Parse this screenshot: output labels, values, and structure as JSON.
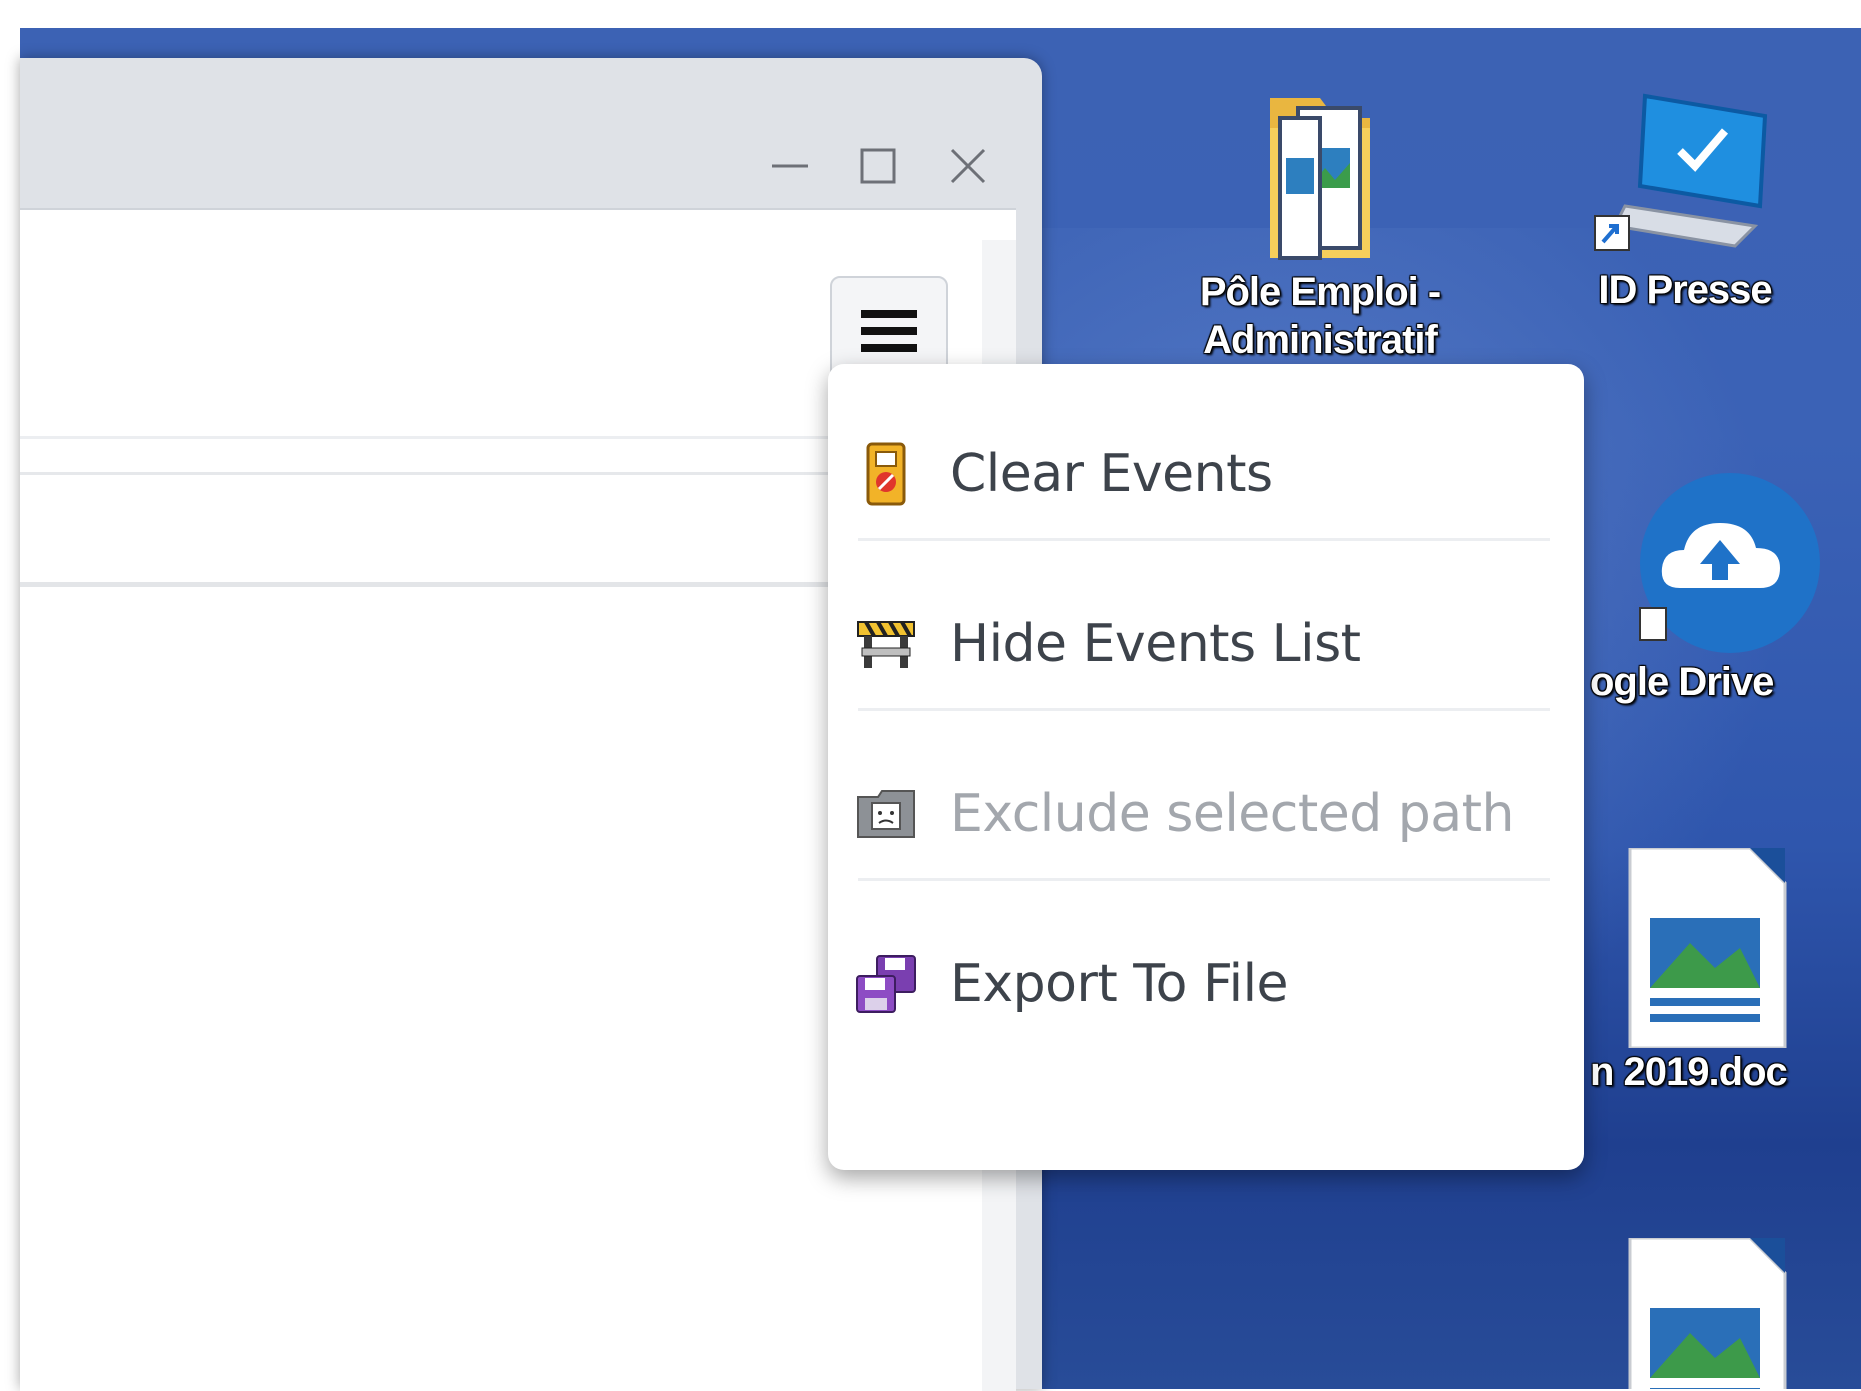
{
  "window": {
    "controls": {
      "minimize_icon": "minimize-icon",
      "maximize_icon": "maximize-icon",
      "close_icon": "close-icon"
    },
    "menu_button_icon": "hamburger-menu-icon"
  },
  "context_menu": {
    "items": [
      {
        "label": "Clear Events",
        "icon": "clear-events-icon",
        "enabled": true
      },
      {
        "label": "Hide Events List",
        "icon": "hide-list-icon",
        "enabled": true
      },
      {
        "label": "Exclude selected path",
        "icon": "exclude-path-icon",
        "enabled": false
      },
      {
        "label": "Export To File",
        "icon": "export-file-icon",
        "enabled": true
      }
    ]
  },
  "desktop": {
    "icons": [
      {
        "label_line1": "Pôle Emploi -",
        "label_line2": "Administratif",
        "icon": "folder-icon"
      },
      {
        "label": "ID Presse",
        "icon": "computer-shortcut-icon"
      },
      {
        "label": "ogle Drive",
        "icon": "cloud-upload-icon"
      },
      {
        "label": "n 2019.doc",
        "icon": "document-icon"
      },
      {
        "label": "",
        "icon": "document-icon"
      }
    ]
  },
  "colors": {
    "desktop_blue": "#3c62b4",
    "window_chrome": "#dfe2e7",
    "menu_text": "#3d434b",
    "menu_text_disabled": "#a3a7ad"
  }
}
